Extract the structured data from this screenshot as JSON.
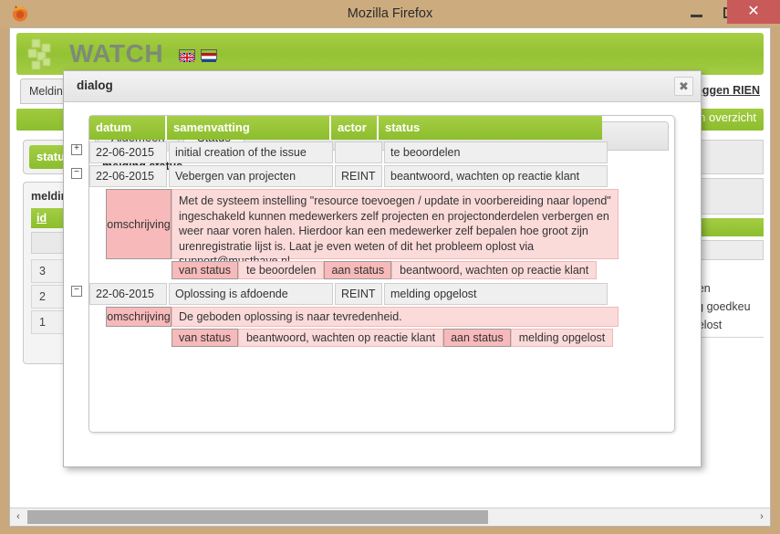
{
  "window": {
    "title": "Mozilla Firefox",
    "minimize_label": "–",
    "maximize_label": "□",
    "close_label": "✕"
  },
  "app": {
    "logo_text": "WATCH",
    "flags": [
      "united-kingdom",
      "netherlands"
    ],
    "nav_tab": "Melding",
    "logout_link": "tloggen RIEN",
    "green_bar_label": "en overzicht",
    "status_button": "status",
    "melding_panel_title": "melding",
    "id_column_header": "id",
    "id_values": [
      "3",
      "2",
      "1"
    ],
    "right_items": [
      "rdelen",
      "hting goedkeu",
      "opgelost"
    ]
  },
  "dialog": {
    "title": "dialog",
    "close_icon": "✖",
    "tabs": [
      {
        "label": "Algemeen",
        "active": false
      },
      {
        "label": "Status",
        "active": true
      }
    ],
    "section_title": "melding status",
    "table": {
      "headers": [
        "datum",
        "samenvatting",
        "actor",
        "status"
      ],
      "rows": [
        {
          "toggle": "+",
          "expanded": false,
          "datum": "22-06-2015",
          "samenvatting": "initial creation of the issue",
          "actor": "",
          "status": "te beoordelen"
        },
        {
          "toggle": "−",
          "expanded": true,
          "datum": "22-06-2015",
          "samenvatting": "Vebergen van projecten",
          "actor": "REINT",
          "status": "beantwoord, wachten op reactie klant",
          "detail": {
            "omschrijving_label": "omschrijving",
            "omschrijving_text": "Met de systeem instelling \"resource toevoegen / update in voorbereiding naar lopend\" ingeschakeld kunnen medewerkers zelf projecten en projectonderdelen verbergen en weer naar voren halen. Hierdoor kan een medewerker zelf bepalen hoe groot zijn urenregistratie lijst is. Laat je even weten of dit het probleem oplost via support@musthave.nl",
            "van_status_label": "van status",
            "van_status_value": "te beoordelen",
            "aan_status_label": "aan status",
            "aan_status_value": "beantwoord, wachten op reactie klant"
          }
        },
        {
          "toggle": "−",
          "expanded": true,
          "datum": "22-06-2015",
          "samenvatting": "Oplossing is afdoende",
          "actor": "REINT",
          "status": "melding opgelost",
          "detail": {
            "omschrijving_label": "omschrijving",
            "omschrijving_text": "De geboden oplossing is naar tevredenheid.",
            "van_status_label": "van status",
            "van_status_value": "beantwoord, wachten op reactie klant",
            "aan_status_label": "aan status",
            "aan_status_value": "melding opgelost"
          }
        }
      ]
    }
  },
  "scrollbar": {
    "left_arrow": "‹",
    "right_arrow": "›"
  },
  "colors": {
    "brand_green": "#8cbe2d",
    "titlebar": "#ccab7e",
    "close_red": "#c85a5a",
    "pink_label": "#f7b9b9",
    "pink_body": "#fbdada"
  }
}
